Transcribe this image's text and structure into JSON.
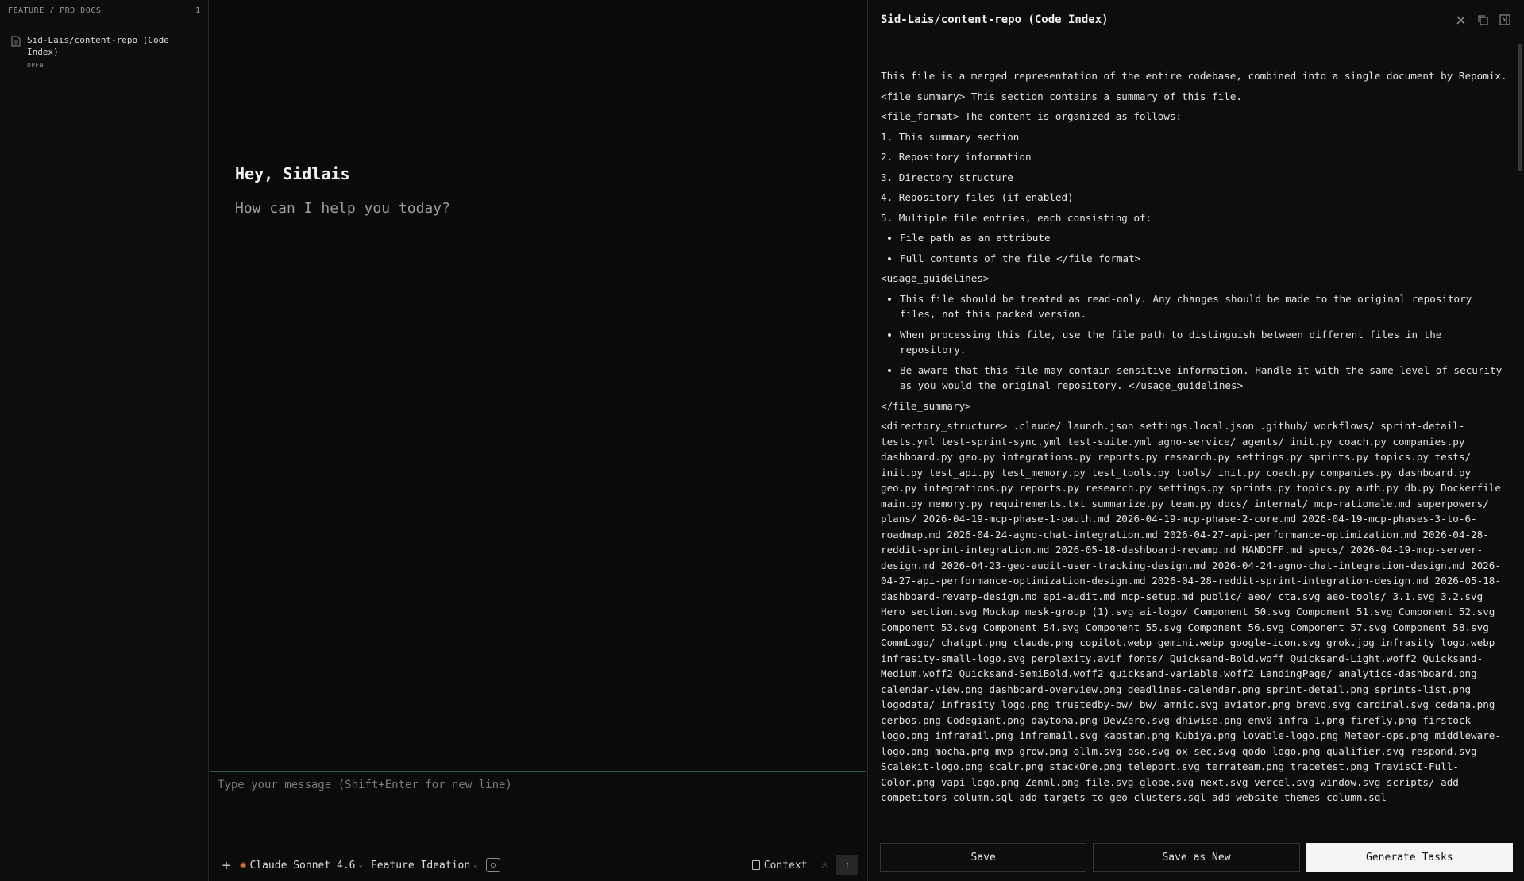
{
  "sidebar": {
    "title": "FEATURE / PRD DOCS",
    "count": "1",
    "docs": [
      {
        "name": "Sid-Lais/content-repo (Code Index)",
        "status": "OPEN"
      }
    ]
  },
  "chat": {
    "greeting": "Hey, Sidlais",
    "subgreeting": "How can I help you today?",
    "input_placeholder": "Type your message (Shift+Enter for new line)",
    "model_label": "Claude Sonnet 4.6",
    "mode_label": "Feature Ideation",
    "context_label": "Context"
  },
  "docpane": {
    "title": "Sid-Lais/content-repo (Code Index)",
    "intro": "This file is a merged representation of the entire codebase, combined into a single document by Repomix.",
    "summary_line": "<file_summary> This section contains a summary of this file.",
    "format_line": "<file_format> The content is organized as follows:",
    "numbered": [
      "1. This summary section",
      "2. Repository information",
      "3. Directory structure",
      "4. Repository files (if enabled)",
      "5. Multiple file entries, each consisting of:"
    ],
    "format_bullets": [
      "File path as an attribute",
      "Full contents of the file </file_format>"
    ],
    "usage_line": "<usage_guidelines>",
    "usage_bullets": [
      "This file should be treated as read-only. Any changes should be made to the original repository files, not this packed version.",
      "When processing this file, use the file path to distinguish between different files in the repository.",
      "Be aware that this file may contain sensitive information. Handle it with the same level of security as you would the original repository. </usage_guidelines>"
    ],
    "summary_close": "</file_summary>",
    "directory_structure": "<directory_structure> .claude/ launch.json settings.local.json .github/ workflows/ sprint-detail-tests.yml test-sprint-sync.yml test-suite.yml agno-service/ agents/ init.py coach.py companies.py dashboard.py geo.py integrations.py reports.py research.py settings.py sprints.py topics.py tests/ init.py test_api.py test_memory.py test_tools.py tools/ init.py coach.py companies.py dashboard.py geo.py integrations.py reports.py research.py settings.py sprints.py topics.py auth.py db.py Dockerfile main.py memory.py requirements.txt summarize.py team.py docs/ internal/ mcp-rationale.md superpowers/ plans/ 2026-04-19-mcp-phase-1-oauth.md 2026-04-19-mcp-phase-2-core.md 2026-04-19-mcp-phases-3-to-6-roadmap.md 2026-04-24-agno-chat-integration.md 2026-04-27-api-performance-optimization.md 2026-04-28-reddit-sprint-integration.md 2026-05-18-dashboard-revamp.md HANDOFF.md specs/ 2026-04-19-mcp-server-design.md 2026-04-23-geo-audit-user-tracking-design.md 2026-04-24-agno-chat-integration-design.md 2026-04-27-api-performance-optimization-design.md 2026-04-28-reddit-sprint-integration-design.md 2026-05-18-dashboard-revamp-design.md api-audit.md mcp-setup.md public/ aeo/ cta.svg aeo-tools/ 3.1.svg 3.2.svg Hero section.svg Mockup_mask-group (1).svg ai-logo/ Component 50.svg Component 51.svg Component 52.svg Component 53.svg Component 54.svg Component 55.svg Component 56.svg Component 57.svg Component 58.svg CommLogo/ chatgpt.png claude.png copilot.webp gemini.webp google-icon.svg grok.jpg infrasity_logo.webp infrasity-small-logo.svg perplexity.avif fonts/ Quicksand-Bold.woff Quicksand-Light.woff2 Quicksand-Medium.woff2 Quicksand-SemiBold.woff2 quicksand-variable.woff2 LandingPage/ analytics-dashboard.png calendar-view.png dashboard-overview.png deadlines-calendar.png sprint-detail.png sprints-list.png logodata/ infrasity_logo.png trustedby-bw/ bw/ amnic.svg aviator.png brevo.svg cardinal.svg cedana.png cerbos.png Codegiant.png daytona.png DevZero.svg dhiwise.png env0-infra-1.png firefly.png firstock-logo.png inframail.png inframail.svg kapstan.png Kubiya.png lovable-logo.png Meteor-ops.png middleware-logo.png mocha.png mvp-grow.png ollm.svg oso.svg ox-sec.svg qodo-logo.png qualifier.svg respond.svg Scalekit-logo.png scalr.png stackOne.png teleport.svg terrateam.png tracetest.png TravisCI-Full-Color.png vapi-logo.png Zenml.png file.svg globe.svg next.svg vercel.svg window.svg scripts/ add-competitors-column.sql add-targets-to-geo-clusters.sql add-website-themes-column.sql",
    "buttons": {
      "save": "Save",
      "save_as_new": "Save as New",
      "generate": "Generate Tasks"
    }
  }
}
